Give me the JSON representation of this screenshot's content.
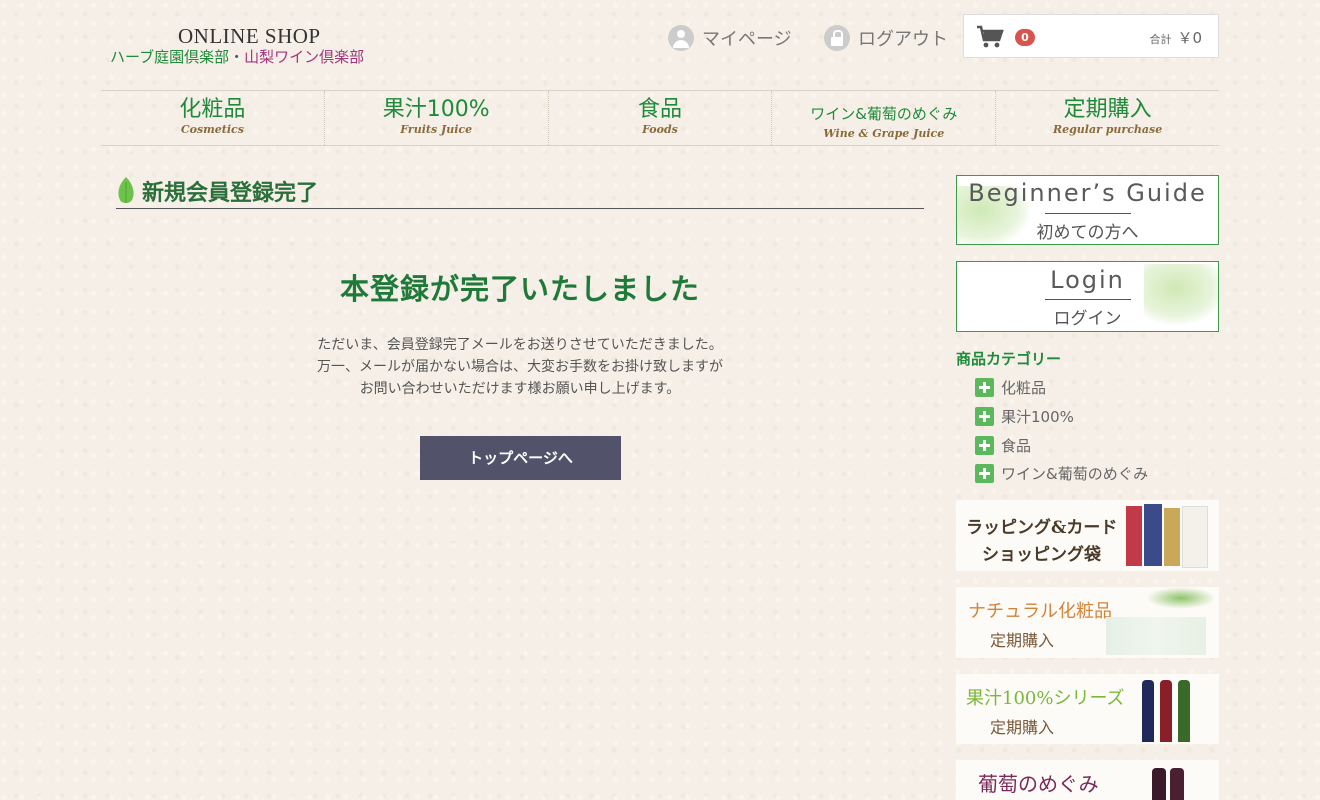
{
  "header": {
    "logo_title": "ONLINE SHOP",
    "logo_sub_green": "ハーブ庭園倶楽部",
    "logo_sub_dot": "・",
    "logo_sub_purple": "山梨ワイン倶楽部",
    "mypage_label": "マイページ",
    "logout_label": "ログアウト",
    "cart_count": "0",
    "cart_total_label": "合計",
    "cart_total_value": "￥0"
  },
  "nav": [
    {
      "jp": "化粧品",
      "en": "Cosmetics"
    },
    {
      "jp": "果汁100%",
      "en": "Fruits Juice"
    },
    {
      "jp": "食品",
      "en": "Foods"
    },
    {
      "jp": "ワイン&葡萄のめぐみ",
      "en": "Wine & Grape Juice"
    },
    {
      "jp": "定期購入",
      "en": "Regular purchase"
    }
  ],
  "main": {
    "section_title": "新規会員登録完了",
    "heading": "本登録が完了いたしました",
    "message_line1": "ただいま、会員登録完了メールをお送りさせていただきました。",
    "message_line2": "万一、メールが届かない場合は、大変お手数をお掛け致しますが",
    "message_line3": "お問い合わせいただけます様お願い申し上げます。",
    "button_label": "トップページへ"
  },
  "sidebar": {
    "guide_en": "Beginner’s Guide",
    "guide_jp": "初めての方へ",
    "login_en": "Login",
    "login_jp": "ログイン",
    "category_title": "商品カテゴリー",
    "categories": [
      "化粧品",
      "果汁100%",
      "食品",
      "ワイン&葡萄のめぐみ"
    ],
    "promos": [
      {
        "line1": "ラッピング&カード",
        "line2": "ショッピング袋"
      },
      {
        "line1": "ナチュラル化粧品",
        "line2": "定期購入"
      },
      {
        "line1": "果汁100%シリーズ",
        "line2": "定期購入"
      },
      {
        "line1": "葡萄のめぐみ"
      }
    ]
  },
  "colors": {
    "brand_green": "#1f8a3a",
    "accent_purple": "#a2357d",
    "button_bg": "#52526a",
    "badge_red": "#d9534f"
  }
}
